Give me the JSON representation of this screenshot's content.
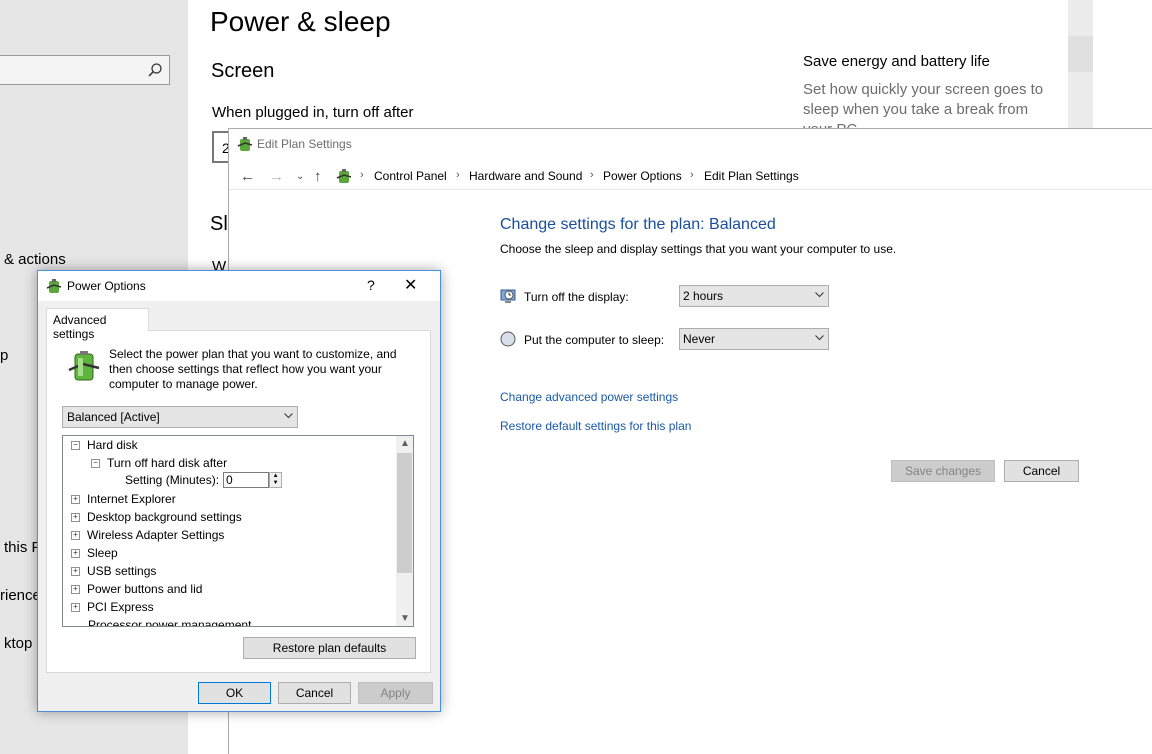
{
  "settings": {
    "page_title": "Power & sleep",
    "screen_heading": "Screen",
    "plugged_in_label": "When plugged in, turn off after",
    "combo_fragment": "2",
    "sleep_heading_fragment": "Sl",
    "when_fragment": "W",
    "nav_fragments": [
      "& actions",
      "p",
      "this P",
      "rience",
      "ktop"
    ],
    "save_energy_title": "Save energy and battery life",
    "save_energy_desc": "Set how quickly your screen goes to sleep when you take a break from your PC."
  },
  "edit_plan": {
    "title": "Edit Plan Settings",
    "breadcrumb": [
      "Control Panel",
      "Hardware and Sound",
      "Power Options",
      "Edit Plan Settings"
    ],
    "heading": "Change settings for the plan: Balanced",
    "description": "Choose the sleep and display settings that you want your computer to use.",
    "display_label": "Turn off the display:",
    "display_value": "2 hours",
    "sleep_label": "Put the computer to sleep:",
    "sleep_value": "Never",
    "advanced_link": "Change advanced power settings",
    "restore_link": "Restore default settings for this plan",
    "save_label": "Save changes",
    "cancel_label": "Cancel"
  },
  "power_options": {
    "title": "Power Options",
    "help_glyph": "?",
    "close_glyph": "✕",
    "tab_label": "Advanced settings",
    "description": "Select the power plan that you want to customize, and then choose settings that reflect how you want your computer to manage power.",
    "plan_value": "Balanced [Active]",
    "tree": {
      "hard_disk": "Hard disk",
      "turn_off_hd": "Turn off hard disk after",
      "setting_label": "Setting (Minutes):",
      "setting_value": "0",
      "items": [
        "Internet Explorer",
        "Desktop background settings",
        "Wireless Adapter Settings",
        "Sleep",
        "USB settings",
        "Power buttons and lid",
        "PCI Express",
        "Processor power management"
      ]
    },
    "restore_label": "Restore plan defaults",
    "ok_label": "OK",
    "cancel_label": "Cancel",
    "apply_label": "Apply"
  },
  "icons": {
    "search": "search-icon",
    "back": "back-arrow-icon",
    "forward": "forward-arrow-icon",
    "up": "up-arrow-icon",
    "recent": "chevron-down-icon",
    "power_options": "power-options-icon",
    "display": "display-clock-icon",
    "sleep": "moon-icon",
    "battery": "battery-plug-icon"
  },
  "colors": {
    "link": "#1a5aa5",
    "heading": "#1a4fa0",
    "dialog_border": "#4a90d9",
    "disabled_text": "#838383"
  }
}
